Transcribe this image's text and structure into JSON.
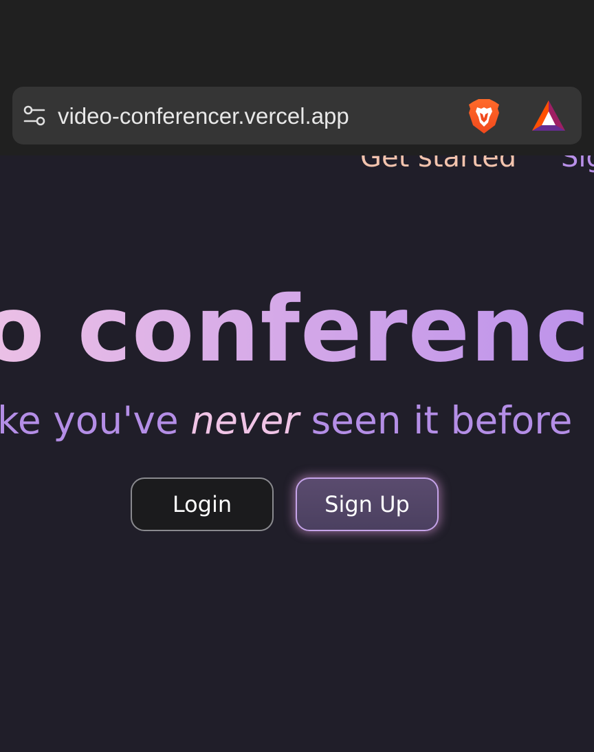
{
  "browser": {
    "url": "video-conferencer.vercel.app",
    "icons": {
      "left": "site-settings-icon",
      "brave": "brave-shields-icon",
      "rewards": "brave-rewards-icon"
    }
  },
  "nav": {
    "get_started": "Get started",
    "sign": "Sig"
  },
  "hero": {
    "title": "o conferencir",
    "subtitle_pre": "ke you've ",
    "subtitle_em": "never",
    "subtitle_post": " seen it before"
  },
  "buttons": {
    "login": "Login",
    "signup": "Sign Up"
  },
  "colors": {
    "page_background": "#201e29",
    "title_gradient_start": "#ecc1e6",
    "title_gradient_end": "#b68ceb",
    "subtitle": "#b48ee6",
    "emphasis": "#f0c4e6",
    "nav_get_started": "#f2c3ad",
    "signup_border": "#c6a4ea"
  }
}
